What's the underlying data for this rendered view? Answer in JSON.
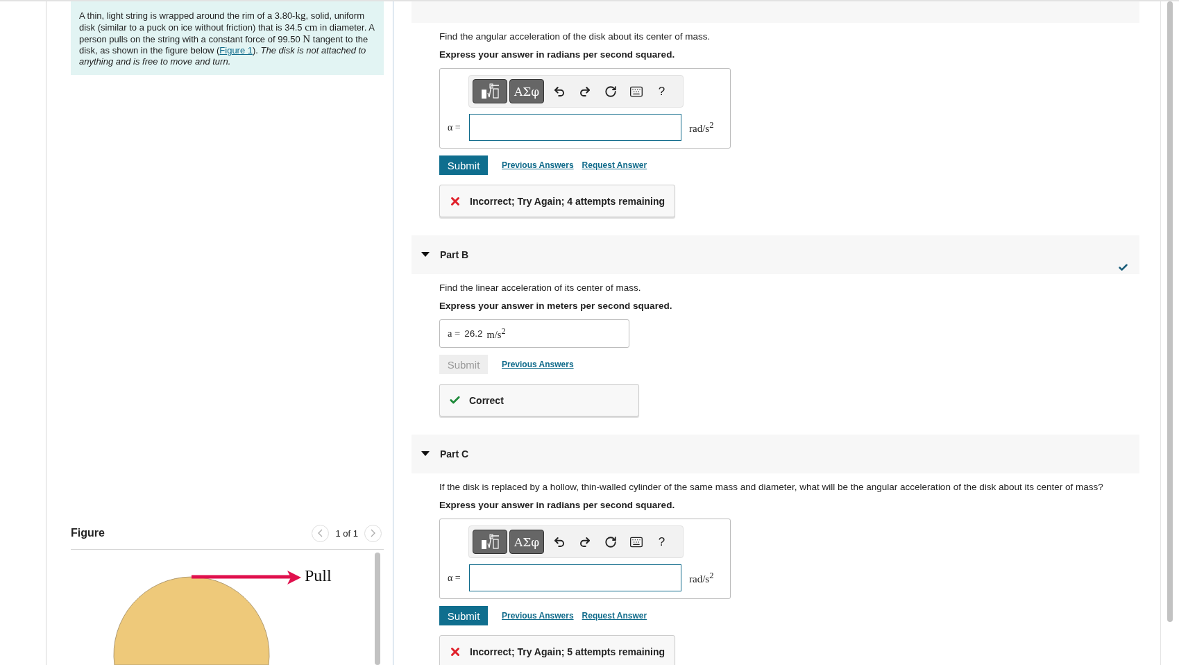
{
  "problem": {
    "segments": [
      {
        "kind": "plain",
        "text": "A thin, light string is wrapped around the rim of a 3.80-"
      },
      {
        "kind": "unit",
        "text": "kg"
      },
      {
        "kind": "plain",
        "text": ", solid, uniform disk (similar to a puck on ice without friction) that is 34.5 "
      },
      {
        "kind": "unit",
        "text": "cm"
      },
      {
        "kind": "plain",
        "text": " in diameter. A person pulls on the string with a constant force of 99.50 "
      },
      {
        "kind": "unit",
        "text": "N"
      },
      {
        "kind": "plain",
        "text": " tangent to the disk, as shown in the figure below ("
      },
      {
        "kind": "link",
        "text": "Figure 1"
      },
      {
        "kind": "plain",
        "text": "). "
      },
      {
        "kind": "italic",
        "text": "The disk is not attached to anything and is free to move and turn."
      }
    ]
  },
  "figure": {
    "title": "Figure",
    "pager": "1 of 1",
    "label": "Pull"
  },
  "parts": [
    {
      "question": "Find the angular acceleration of the disk about its center of mass.",
      "instruction": "Express your answer in radians per second squared.",
      "answer": {
        "kind": "editor",
        "toolbar": [
          {
            "kind": "template"
          },
          {
            "kind": "symbols",
            "label": "ΑΣφ"
          },
          {
            "kind": "undo"
          },
          {
            "kind": "redo"
          },
          {
            "kind": "reset"
          },
          {
            "kind": "keyboard"
          },
          {
            "kind": "help",
            "label": "?"
          }
        ],
        "variable": "α =",
        "unit": "rad/s$^{2}$"
      },
      "submit": {
        "label": "Submit",
        "disabled": false
      },
      "links": [
        "Previous Answers",
        "Request Answer"
      ],
      "feedback": {
        "kind": "incorrect",
        "text": "Incorrect; Try Again; 4 attempts remaining"
      }
    },
    {
      "title": "Part B",
      "expanded": true,
      "complete": true,
      "question": "Find the linear acceleration of its center of mass.",
      "instruction": "Express your answer in meters per second squared.",
      "answer": {
        "kind": "submitted",
        "variable": "a =",
        "value": "26.2",
        "unit": "m/s$^{2}$"
      },
      "submit": {
        "label": "Submit",
        "disabled": true
      },
      "links": [
        "Previous Answers"
      ],
      "feedback": {
        "kind": "correct",
        "text": "Correct"
      }
    },
    {
      "title": "Part C",
      "expanded": true,
      "question": "If the disk is replaced by a hollow, thin-walled cylinder of the same mass and diameter, what will be the angular acceleration of the disk about its center of mass?",
      "instruction": "Express your answer in radians per second squared.",
      "answer": {
        "kind": "editor",
        "toolbar": [
          {
            "kind": "template"
          },
          {
            "kind": "symbols",
            "label": "ΑΣφ"
          },
          {
            "kind": "undo"
          },
          {
            "kind": "redo"
          },
          {
            "kind": "reset"
          },
          {
            "kind": "keyboard"
          },
          {
            "kind": "help",
            "label": "?"
          }
        ],
        "variable": "α =",
        "unit": "rad/s$^{2}$"
      },
      "submit": {
        "label": "Submit",
        "disabled": false
      },
      "links": [
        "Previous Answers",
        "Request Answer"
      ],
      "feedback": {
        "kind": "incorrect",
        "text": "Incorrect; Try Again; 5 attempts remaining"
      }
    }
  ]
}
